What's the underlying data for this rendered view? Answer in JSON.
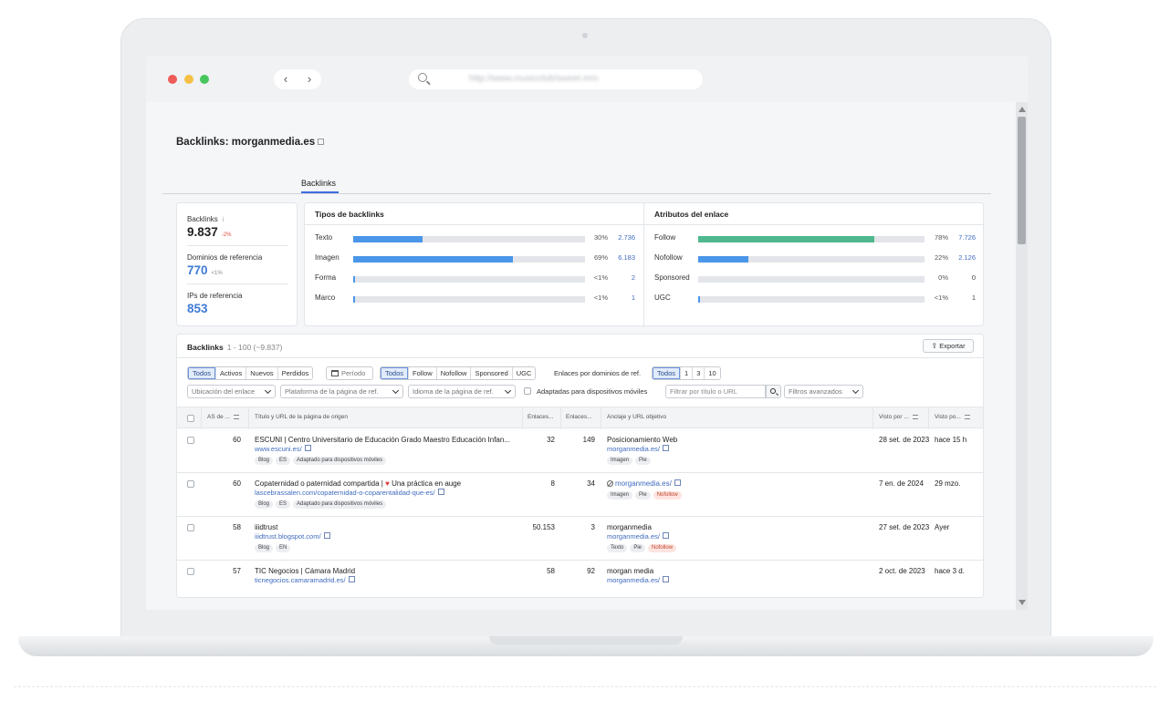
{
  "browser": {
    "url": "http://www.musicclub/sweet.mm",
    "back": "‹",
    "forward": "›"
  },
  "page": {
    "title_prefix": "Backlinks:",
    "domain": "morganmedia.es",
    "tab": "Backlinks"
  },
  "summary": {
    "backlinks_label": "Backlinks",
    "backlinks_info": "i",
    "backlinks_value": "9.837",
    "backlinks_delta": "-2%",
    "domains_label": "Dominios de referencia",
    "domains_value": "770",
    "domains_delta": "<1%",
    "ips_label": "IPs de referencia",
    "ips_value": "853"
  },
  "types": {
    "title": "Tipos de backlinks",
    "rows": [
      {
        "label": "Texto",
        "pct": "30%",
        "count": "2.736",
        "fraction": 0.3
      },
      {
        "label": "Imagen",
        "pct": "69%",
        "count": "6.183",
        "fraction": 0.69
      },
      {
        "label": "Forma",
        "pct": "<1%",
        "count": "2",
        "fraction": 0.004
      },
      {
        "label": "Marco",
        "pct": "<1%",
        "count": "1",
        "fraction": 0.004
      }
    ]
  },
  "attributes": {
    "title": "Atributos del enlace",
    "rows": [
      {
        "label": "Follow",
        "pct": "78%",
        "count": "7.726",
        "fraction": 0.78,
        "color": "#4fb88f"
      },
      {
        "label": "Nofollow",
        "pct": "22%",
        "count": "2.126",
        "fraction": 0.22,
        "color": "#4a96e8"
      },
      {
        "label": "Sponsored",
        "pct": "0%",
        "count": "0",
        "fraction": 0,
        "color": "#4a96e8"
      },
      {
        "label": "UGC",
        "pct": "<1%",
        "count": "1",
        "fraction": 0.004,
        "color": "#4a96e8"
      }
    ]
  },
  "colors": {
    "accent": "#3d6de0",
    "bar_blue": "#4a96e8",
    "bar_green": "#4fb88f",
    "value_blue": "#3f7bd6",
    "delta_red": "#e04b3c"
  },
  "table": {
    "title": "Backlinks",
    "range": "1 - 100 (~9.837)",
    "export": "Exportar",
    "filters": {
      "status": [
        "Todos",
        "Activos",
        "Nuevos",
        "Perdidos"
      ],
      "period": "Período",
      "attrs": [
        "Todos",
        "Follow",
        "Nofollow",
        "Sponsored",
        "UGC"
      ],
      "per_domain_label": "Enlaces por dominios de ref.",
      "per_domain": [
        "Todos",
        "1",
        "3",
        "10"
      ],
      "location": "Ubicación del enlace",
      "platform": "Plataforma de la página de ref.",
      "language": "Idioma de la página de ref.",
      "mobile": "Adaptadas para dispositivos móviles",
      "search_placeholder": "Filtrar por título o URL",
      "advanced": "Filtros avanzados"
    },
    "headers": {
      "as": "AS de ...",
      "title": "Título y URL de la página de origen",
      "ext": "Enlaces...",
      "int": "Enlaces...",
      "anchor": "Anclaje y URL objetivo",
      "first_seen": "Visto por ...",
      "last_seen": "Visto po..."
    },
    "rows": [
      {
        "as": "60",
        "title": "ESCUNI | Centro Universitario de Educación Grado Maestro Educación Infan...",
        "url": "www.escuni.es/",
        "tags": [
          "Blog",
          "ES",
          "Adaptado para dispositivos móviles"
        ],
        "ext": "32",
        "int": "149",
        "anchor": "Posicionamiento Web",
        "target": "morganmedia.es/",
        "anchor_tags": [
          "Imagen",
          "Pie"
        ],
        "anchor_red_tag": "",
        "first": "28 set. de 2023",
        "last": "hace 15 h"
      },
      {
        "as": "60",
        "title": "Copaternidad o paternidad compartida",
        "title_suffix": "Una práctica en auge",
        "url": "lascebrassalen.com/copaternidad-o-coparentalidad-que-es/",
        "tags": [
          "Blog",
          "ES",
          "Adaptado para dispositivos móviles"
        ],
        "ext": "8",
        "int": "34",
        "anchor": "",
        "target": "morganmedia.es/",
        "anchor_tags": [
          "Imagen",
          "Pie"
        ],
        "anchor_red_tag": "Nofollow",
        "first": "7 en. de 2024",
        "last": "29 mzo."
      },
      {
        "as": "58",
        "title": "iiidtrust",
        "url": "iiidtrust.blogspot.com/",
        "tags": [
          "Blog",
          "EN"
        ],
        "ext": "50.153",
        "int": "3",
        "anchor": "morganmedia",
        "target": "morganmedia.es/",
        "anchor_tags": [
          "Texto",
          "Pie"
        ],
        "anchor_red_tag": "Nofollow",
        "first": "27 set. de 2023",
        "last": "Ayer"
      },
      {
        "as": "57",
        "title": "TIC Negocios | Cámara Madrid",
        "url": "ticnegocios.camaramadrid.es/",
        "tags": [],
        "ext": "58",
        "int": "92",
        "anchor": "morgan media",
        "target": "morganmedia.es/",
        "anchor_tags": [],
        "anchor_red_tag": "",
        "first": "2 oct. de 2023",
        "last": "hace 3 d."
      }
    ]
  }
}
